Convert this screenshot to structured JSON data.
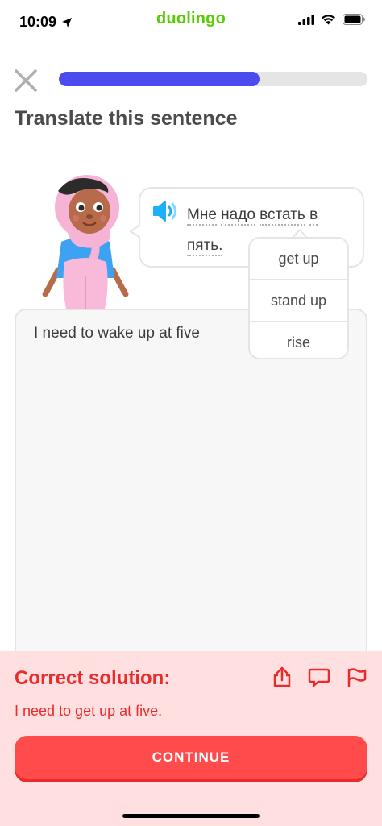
{
  "status_bar": {
    "time": "10:09",
    "brand": "duolingo"
  },
  "header": {
    "progress_fraction": 0.65
  },
  "prompt": "Translate this sentence",
  "sentence": {
    "words": [
      "Мне",
      "надо",
      "встать",
      "в",
      "пять."
    ]
  },
  "hint": {
    "options": [
      "get up",
      "stand up",
      "rise"
    ]
  },
  "answer": {
    "text": "I need to wake up at five"
  },
  "feedback": {
    "title": "Correct solution:",
    "solution": "I need to get up at five.",
    "continue_label": "CONTINUE"
  },
  "colors": {
    "brand": "#58cc02",
    "progress": "#4b4bf0",
    "error": "#ea2b2b",
    "button": "#ff4b4b",
    "panel": "#ffdfe0"
  },
  "icons": [
    "location-arrow-icon",
    "signal-icon",
    "wifi-icon",
    "battery-icon",
    "close-icon",
    "speaker-icon",
    "share-icon",
    "comment-icon",
    "flag-icon"
  ]
}
